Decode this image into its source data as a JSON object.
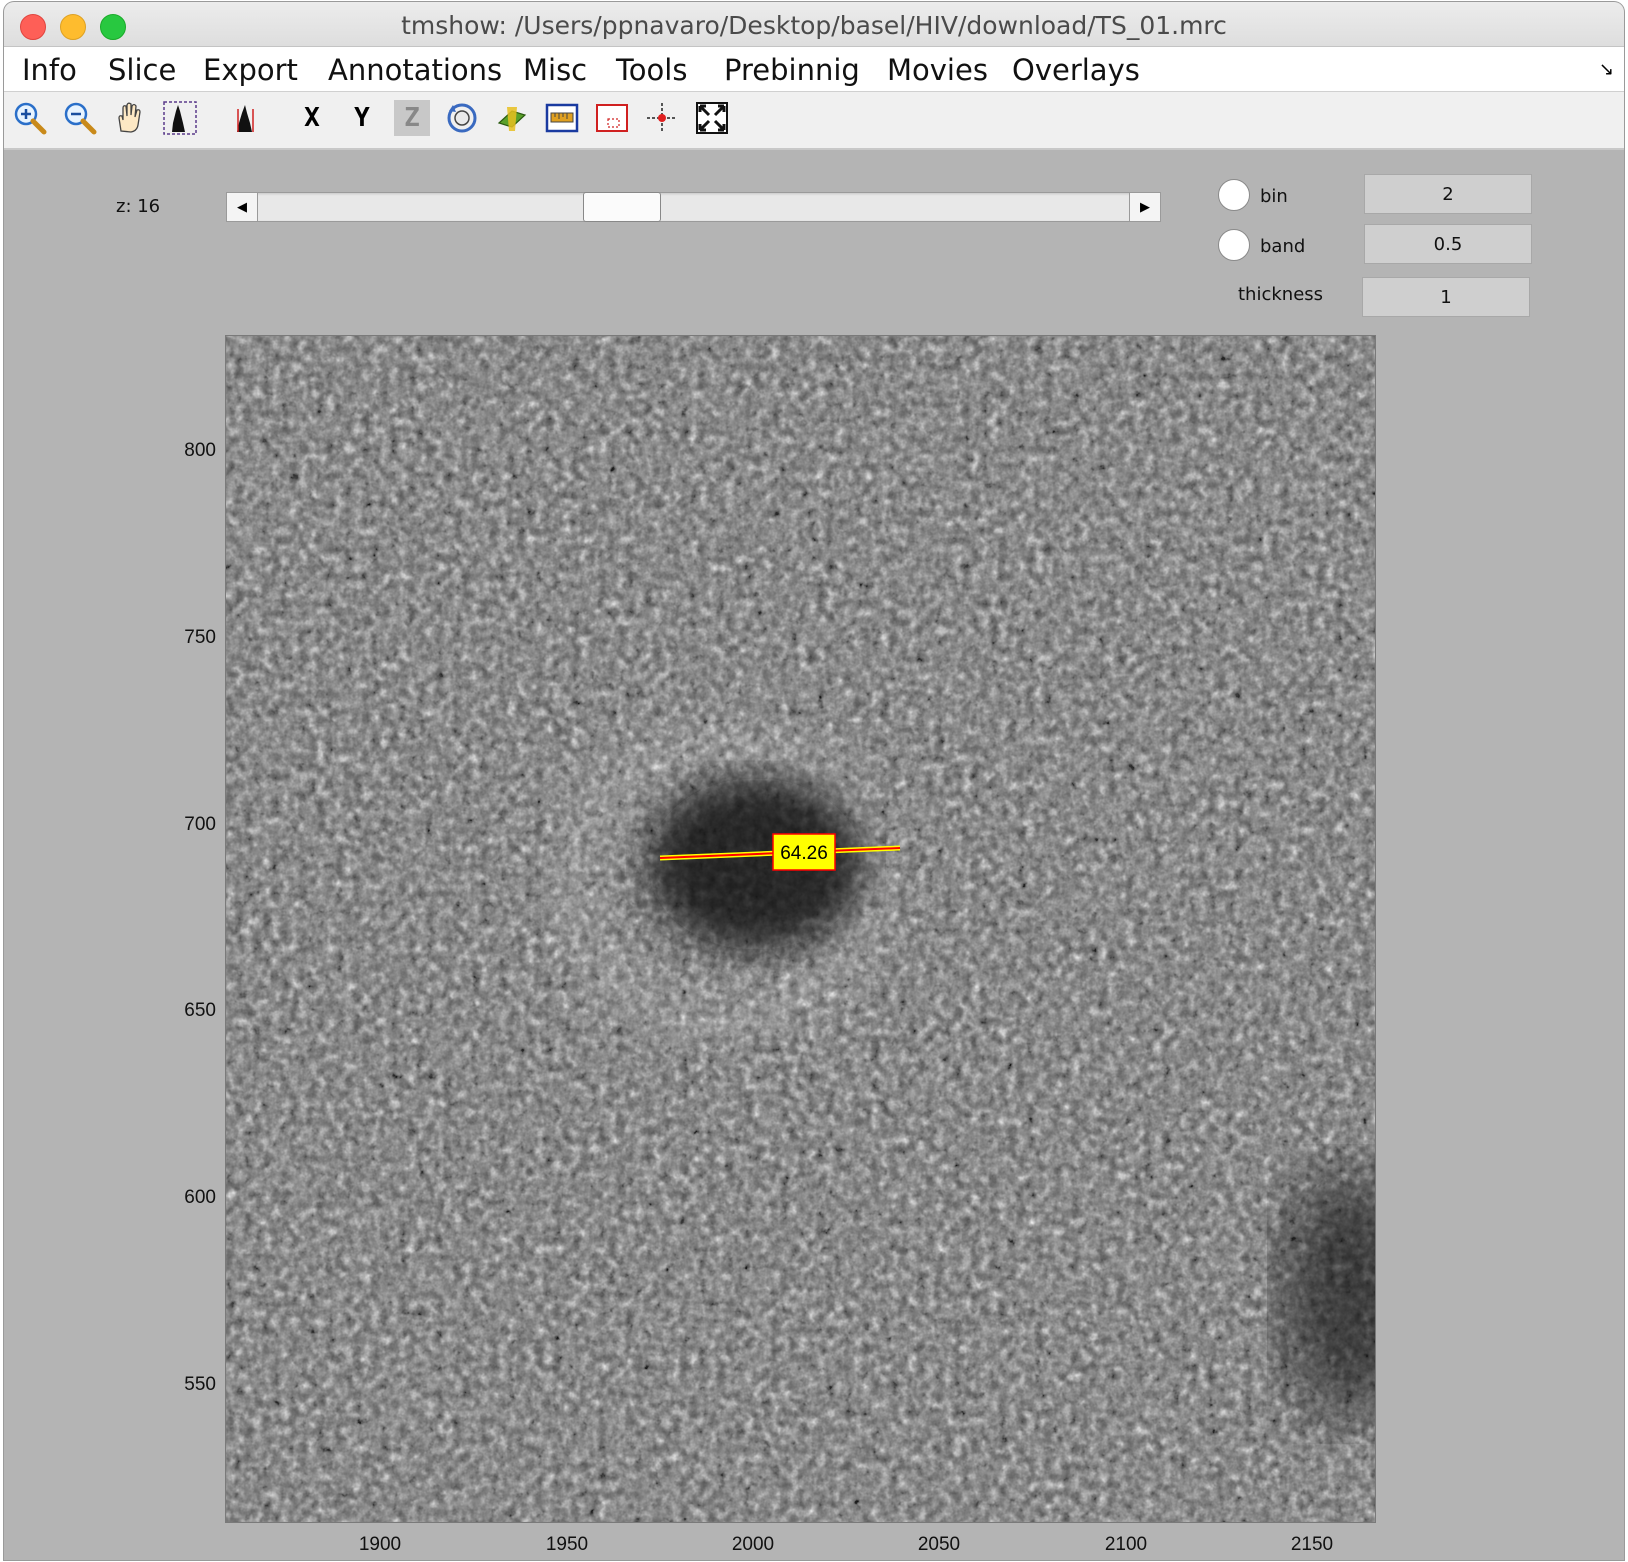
{
  "window": {
    "title": "tmshow: /Users/ppnavaro/Desktop/basel/HIV/download/TS_01.mrc"
  },
  "menu": [
    "Info",
    "Slice",
    "Export",
    "Annotations",
    "Misc",
    "Tools",
    "Prebinnig",
    "Movies",
    "Overlays"
  ],
  "toolbar": {
    "icons": [
      "zoom-in-icon",
      "zoom-out-icon",
      "pan-hand-icon",
      "histogram-icon",
      "histogram-contrast-icon",
      "x-axis-icon",
      "y-axis-icon",
      "z-axis-icon",
      "rotate-icon",
      "flip-icon",
      "measure-ruler-icon",
      "box-select-icon",
      "crosshair-icon",
      "fit-to-window-icon"
    ],
    "x_label": "X",
    "y_label": "Y",
    "z_label": "Z"
  },
  "controls": {
    "z_label": "z: 16",
    "z_slider_fraction": 0.41,
    "bin_label": "bin",
    "bin_value": "2",
    "band_label": "band",
    "band_value": "0.5",
    "thickness_label": "thickness",
    "thickness_value": "1"
  },
  "image": {
    "y_ticks": [
      "800",
      "750",
      "700",
      "650",
      "600",
      "550"
    ],
    "x_ticks": [
      "1900",
      "1950",
      "2000",
      "2050",
      "2100",
      "2150"
    ],
    "measurement": {
      "label": "64.26",
      "line_color": "#ff0000",
      "label_bg": "#ffff00"
    }
  }
}
